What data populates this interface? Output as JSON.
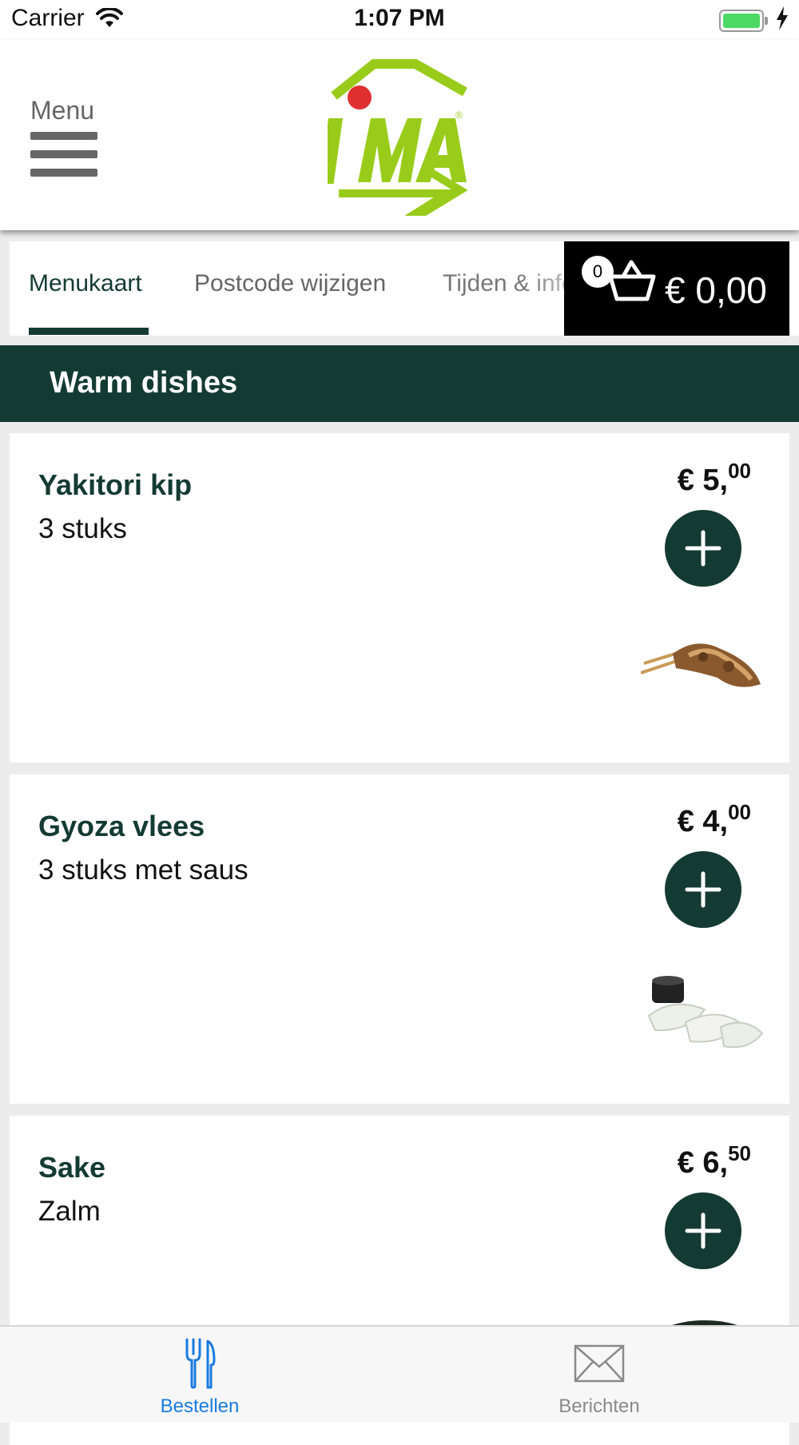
{
  "status_bar": {
    "carrier": "Carrier",
    "time": "1:07 PM",
    "battery_level": 1.0
  },
  "header": {
    "menu_label": "Menu",
    "logo_alt": "IMA"
  },
  "tabs": [
    {
      "label": "Menukaart",
      "active": true
    },
    {
      "label": "Postcode wijzigen",
      "active": false
    },
    {
      "label": "Tijden & info",
      "active": false
    }
  ],
  "cart": {
    "count": "0",
    "total": "€ 0,00"
  },
  "section": {
    "title": "Warm dishes"
  },
  "items": [
    {
      "name": "Yakitori kip",
      "description": "3 stuks",
      "price_main": "€ 5,",
      "price_cents": "00",
      "image": "yakitori-skewer"
    },
    {
      "name": "Gyoza vlees",
      "description": "3 stuks met saus",
      "price_main": "€ 4,",
      "price_cents": "00",
      "image": "gyoza-dumplings"
    },
    {
      "name": "Sake",
      "description": "Zalm",
      "price_main": "€ 6,",
      "price_cents": "50",
      "image": "salmon-bowl"
    }
  ],
  "bottom_tabs": [
    {
      "label": "Bestellen",
      "icon": "fork-knife-icon",
      "active": true
    },
    {
      "label": "Berichten",
      "icon": "envelope-icon",
      "active": false
    }
  ],
  "colors": {
    "primary": "#143b33",
    "logo_green": "#99cc1a",
    "logo_red": "#e03030",
    "active_tab_blue": "#1a7ae0"
  }
}
